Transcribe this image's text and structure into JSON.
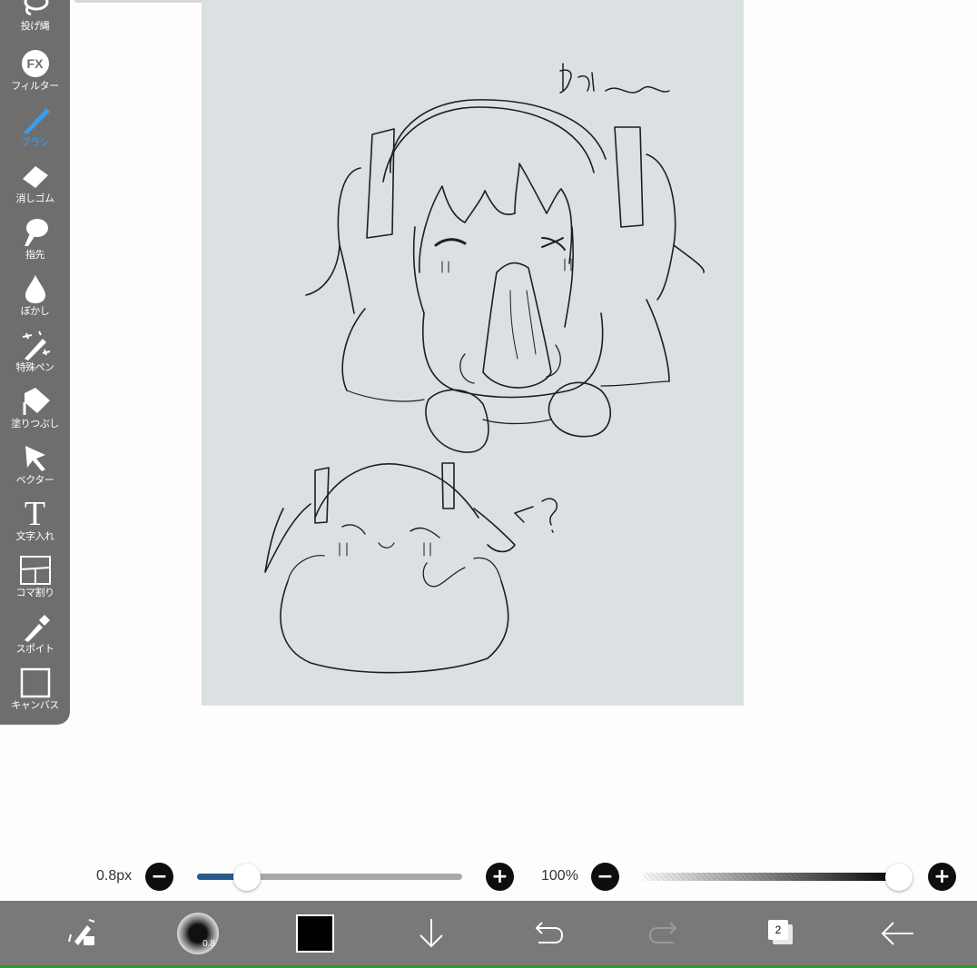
{
  "toolbar": {
    "items": [
      {
        "label": "投げ縄",
        "icon": "lasso-icon"
      },
      {
        "label": "フィルター",
        "icon": "fx-icon",
        "icon_text": "FX"
      },
      {
        "label": "ブラシ",
        "icon": "brush-icon",
        "active": true
      },
      {
        "label": "消しゴム",
        "icon": "eraser-icon"
      },
      {
        "label": "指先",
        "icon": "finger-icon"
      },
      {
        "label": "ぼかし",
        "icon": "blur-drop-icon"
      },
      {
        "label": "特殊ペン",
        "icon": "magic-wand-icon"
      },
      {
        "label": "塗りつぶし",
        "icon": "fill-bucket-icon"
      },
      {
        "label": "ベクター",
        "icon": "arrow-cursor-icon"
      },
      {
        "label": "文字入れ",
        "icon": "text-icon",
        "icon_text": "T"
      },
      {
        "label": "コマ割り",
        "icon": "panel-split-icon"
      },
      {
        "label": "スポイト",
        "icon": "eyedropper-icon"
      },
      {
        "label": "キャンバス",
        "icon": "canvas-icon"
      }
    ],
    "active_color": "#3d9ce8"
  },
  "canvas": {
    "sketch_text_top": "もち〜〜",
    "sketch_text_bottom": "←?"
  },
  "brush_controls": {
    "size_label": "0.8px",
    "size_fraction": 0.19,
    "opacity_label": "100%",
    "opacity_fraction": 1.0
  },
  "bottom_bar": {
    "brush_size_badge": "0.8",
    "current_color": "#000000",
    "layer_count": "2"
  }
}
